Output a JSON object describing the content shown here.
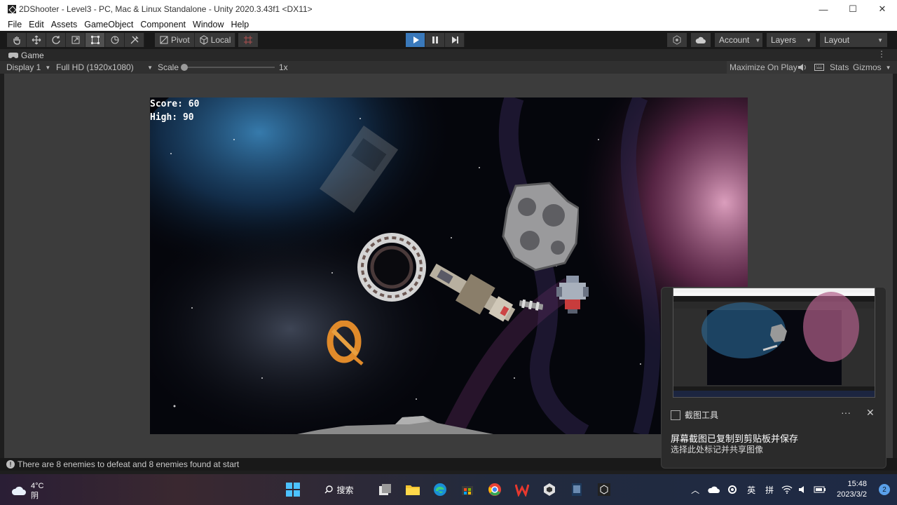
{
  "window": {
    "title": "2DShooter - Level3 - PC, Mac & Linux Standalone - Unity 2020.3.43f1 <DX11>",
    "controls": {
      "minimize": "—",
      "maximize": "☐",
      "close": "✕"
    }
  },
  "menu": [
    "File",
    "Edit",
    "Assets",
    "GameObject",
    "Component",
    "Window",
    "Help"
  ],
  "toolbar": {
    "tools": [
      "hand-tool",
      "move-tool",
      "rotate-tool",
      "scale-tool",
      "rect-tool",
      "transform-tool",
      "custom-tool"
    ],
    "active_tool": "rect-tool",
    "pivot_label": "Pivot",
    "local_label": "Local",
    "account_label": "Account",
    "layers_label": "Layers",
    "layout_label": "Layout",
    "play_active": true
  },
  "game_tab": {
    "label": "Game",
    "display": "Display 1",
    "resolution": "Full HD (1920x1080)",
    "scale_label": "Scale",
    "scale_value": "1x",
    "scale_fraction": 0.0,
    "maximize_label": "Maximize On Play",
    "stats_label": "Stats",
    "gizmos_label": "Gizmos"
  },
  "hud": {
    "score": "Score: 60",
    "high": "High: 90"
  },
  "status": {
    "message": "There are 8 enemies to defeat and 8 enemies found at start"
  },
  "taskbar": {
    "temperature": "4°C",
    "weather": "阴",
    "search_label": "搜索",
    "ime_1": "英",
    "ime_2": "拼",
    "time": "15:48",
    "date": "2023/3/2",
    "notifications": "2"
  },
  "toast": {
    "app_name": "截图工具",
    "title": "屏幕截图已复制到剪贴板并保存",
    "body": "选择此处标记并共享图像",
    "more": "···",
    "close": "✕"
  },
  "colors": {
    "accent_play": "#3a79bb",
    "editor_bg": "#3c3c3c",
    "toolbar_bg": "#191919"
  }
}
